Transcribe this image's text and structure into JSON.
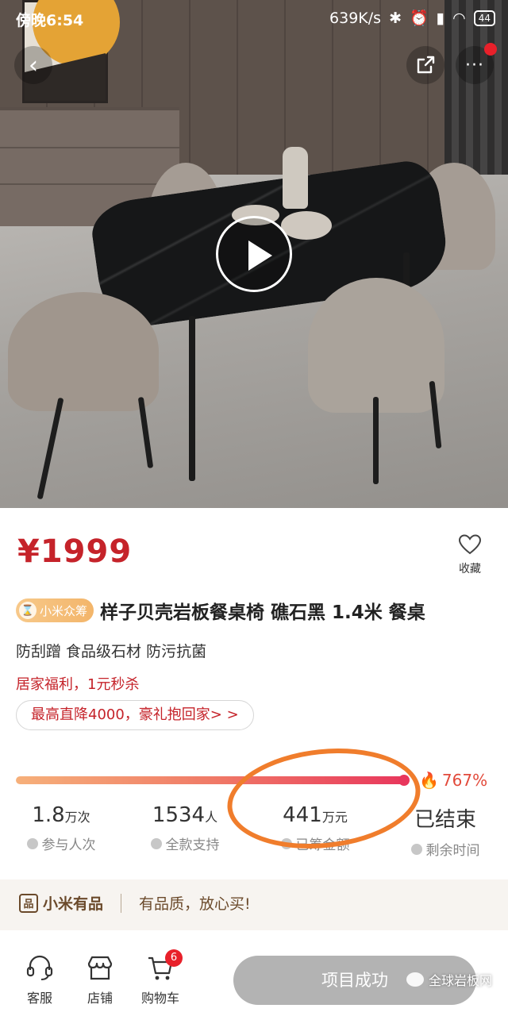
{
  "status_bar": {
    "time": "傍晚6:54",
    "net_speed": "639K/s",
    "battery": "44"
  },
  "product": {
    "price": "¥1999",
    "favorite_label": "收藏",
    "crowd_badge": "小米众筹",
    "title": "样子贝壳岩板餐桌椅 礁石黑 1.4米 餐桌",
    "features": "防刮蹭 食品级石材 防污抗菌",
    "promo_text": "居家福利，1元秒杀",
    "promo_pill": "最高直降4000，豪礼抱回家> >"
  },
  "progress": {
    "percent_label": "767%",
    "fill_fraction": 1.0
  },
  "stats": [
    {
      "value": "1.8",
      "unit": "万次",
      "label": "参与人次"
    },
    {
      "value": "1534",
      "unit": "人",
      "label": "全款支持"
    },
    {
      "value": "441",
      "unit": "万元",
      "label": "已筹金额"
    },
    {
      "value": "已结束",
      "unit": "",
      "label": "剩余时间"
    }
  ],
  "youpin": {
    "brand": "小米有品",
    "slogan": "有品质，放心买!"
  },
  "bottom_bar": {
    "service": "客服",
    "shop": "店铺",
    "cart": "购物车",
    "cart_count": "6",
    "action": "项目成功"
  },
  "watermark": "全球岩板网",
  "colors": {
    "price_red": "#c5232a",
    "progress_end": "#e8365c",
    "highlight": "#f07d2c",
    "action_gray": "#b3b3b3"
  }
}
